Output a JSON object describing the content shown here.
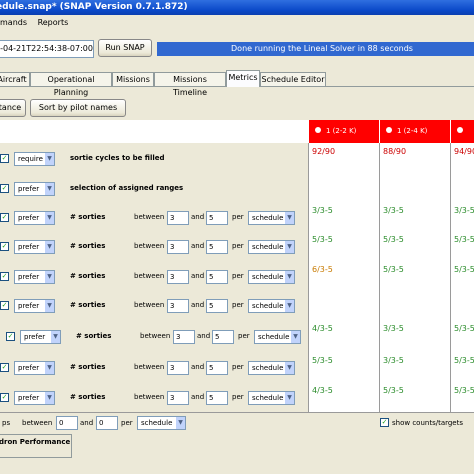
{
  "window": {
    "title": "edule.snap* (SNAP Version 0.7.1.872)"
  },
  "menu": [
    "mands",
    "Reports"
  ],
  "toolbar": {
    "timestamp": "4-04-21T22:54:38-07:00)",
    "run_label": "Run SNAP",
    "status": "Done running the Lineal Solver in 88 seconds"
  },
  "tabs": [
    "Aircraft",
    "Operational Planning",
    "Missions",
    "Missions Timeline",
    "Metrics",
    "Schedule Editor"
  ],
  "sort": {
    "left_label": "tance",
    "pilot_label": "Sort by pilot names"
  },
  "columns": [
    {
      "label": "1 (2-2 K)",
      "color": "#ff0000"
    },
    {
      "label": "1 (2-4 K)",
      "color": "#ff0000"
    },
    {
      "label": "",
      "color": "#ff0000"
    }
  ],
  "rows": [
    {
      "check": "✓",
      "mode": "require",
      "metric": "sortie cycles to be filled",
      "range": false,
      "values": [
        "92/90",
        "88/90",
        "94/90"
      ],
      "colors": [
        "#cc0000",
        "#cc0000",
        "#cc0000"
      ]
    },
    {
      "check": "✓",
      "mode": "prefer",
      "metric": "selection of assigned ranges",
      "range": false,
      "values": [
        "",
        "",
        ""
      ],
      "colors": [
        "#000",
        "#000",
        "#000"
      ]
    },
    {
      "check": "✓",
      "mode": "prefer",
      "metric": "# sorties",
      "range": true,
      "between": "between",
      "low": "3",
      "and": "and",
      "high": "5",
      "per": "per",
      "period": "schedule",
      "values": [
        "3/3-5",
        "3/3-5",
        "3/3-5"
      ],
      "colors": [
        "#2a8c2a",
        "#2a8c2a",
        "#2a8c2a"
      ]
    },
    {
      "check": "✓",
      "mode": "prefer",
      "metric": "# sorties",
      "range": true,
      "between": "between",
      "low": "3",
      "and": "and",
      "high": "5",
      "per": "per",
      "period": "schedule",
      "values": [
        "5/3-5",
        "5/3-5",
        "5/3-5"
      ],
      "colors": [
        "#2a8c2a",
        "#2a8c2a",
        "#2a8c2a"
      ]
    },
    {
      "check": "✓",
      "mode": "prefer",
      "metric": "# sorties",
      "range": true,
      "between": "between",
      "low": "3",
      "and": "and",
      "high": "5",
      "per": "per",
      "period": "schedule",
      "values": [
        "6/3-5",
        "5/3-5",
        "5/3-5"
      ],
      "colors": [
        "#c87a00",
        "#2a8c2a",
        "#2a8c2a"
      ]
    },
    {
      "check": "✓",
      "mode": "prefer",
      "metric": "# sorties",
      "range": true,
      "between": "between",
      "low": "3",
      "and": "and",
      "high": "5",
      "per": "per",
      "period": "schedule",
      "values": [
        "",
        "",
        ""
      ],
      "colors": [
        "#2a8c2a",
        "#2a8c2a",
        "#2a8c2a"
      ]
    },
    {
      "check": "✓",
      "mode": "prefer",
      "metric": "# sorties",
      "range": true,
      "between": "between",
      "low": "3",
      "and": "and",
      "high": "5",
      "per": "per",
      "period": "schedule",
      "values": [
        "4/3-5",
        "3/3-5",
        "5/3-5"
      ],
      "colors": [
        "#2a8c2a",
        "#2a8c2a",
        "#2a8c2a"
      ]
    },
    {
      "check": "✓",
      "mode": "prefer",
      "metric": "# sorties",
      "range": true,
      "between": "between",
      "low": "3",
      "and": "and",
      "high": "5",
      "per": "per",
      "period": "schedule",
      "values": [
        "5/3-5",
        "3/3-5",
        "5/3-5"
      ],
      "colors": [
        "#2a8c2a",
        "#2a8c2a",
        "#2a8c2a"
      ]
    },
    {
      "check": "✓",
      "mode": "prefer",
      "metric": "# sorties",
      "range": true,
      "between": "between",
      "low": "3",
      "and": "and",
      "high": "5",
      "per": "per",
      "period": "schedule",
      "values": [
        "4/3-5",
        "5/3-5",
        "5/3-5"
      ],
      "colors": [
        "#2a8c2a",
        "#2a8c2a",
        "#2a8c2a"
      ]
    }
  ],
  "bottom": {
    "prefix": "ps",
    "between": "between",
    "low": "0",
    "and": "and",
    "high": "0",
    "per": "per",
    "period": "schedule",
    "show_label": "show counts/targets",
    "show_checked": "✓"
  },
  "bottom_tab": "dron Performance"
}
